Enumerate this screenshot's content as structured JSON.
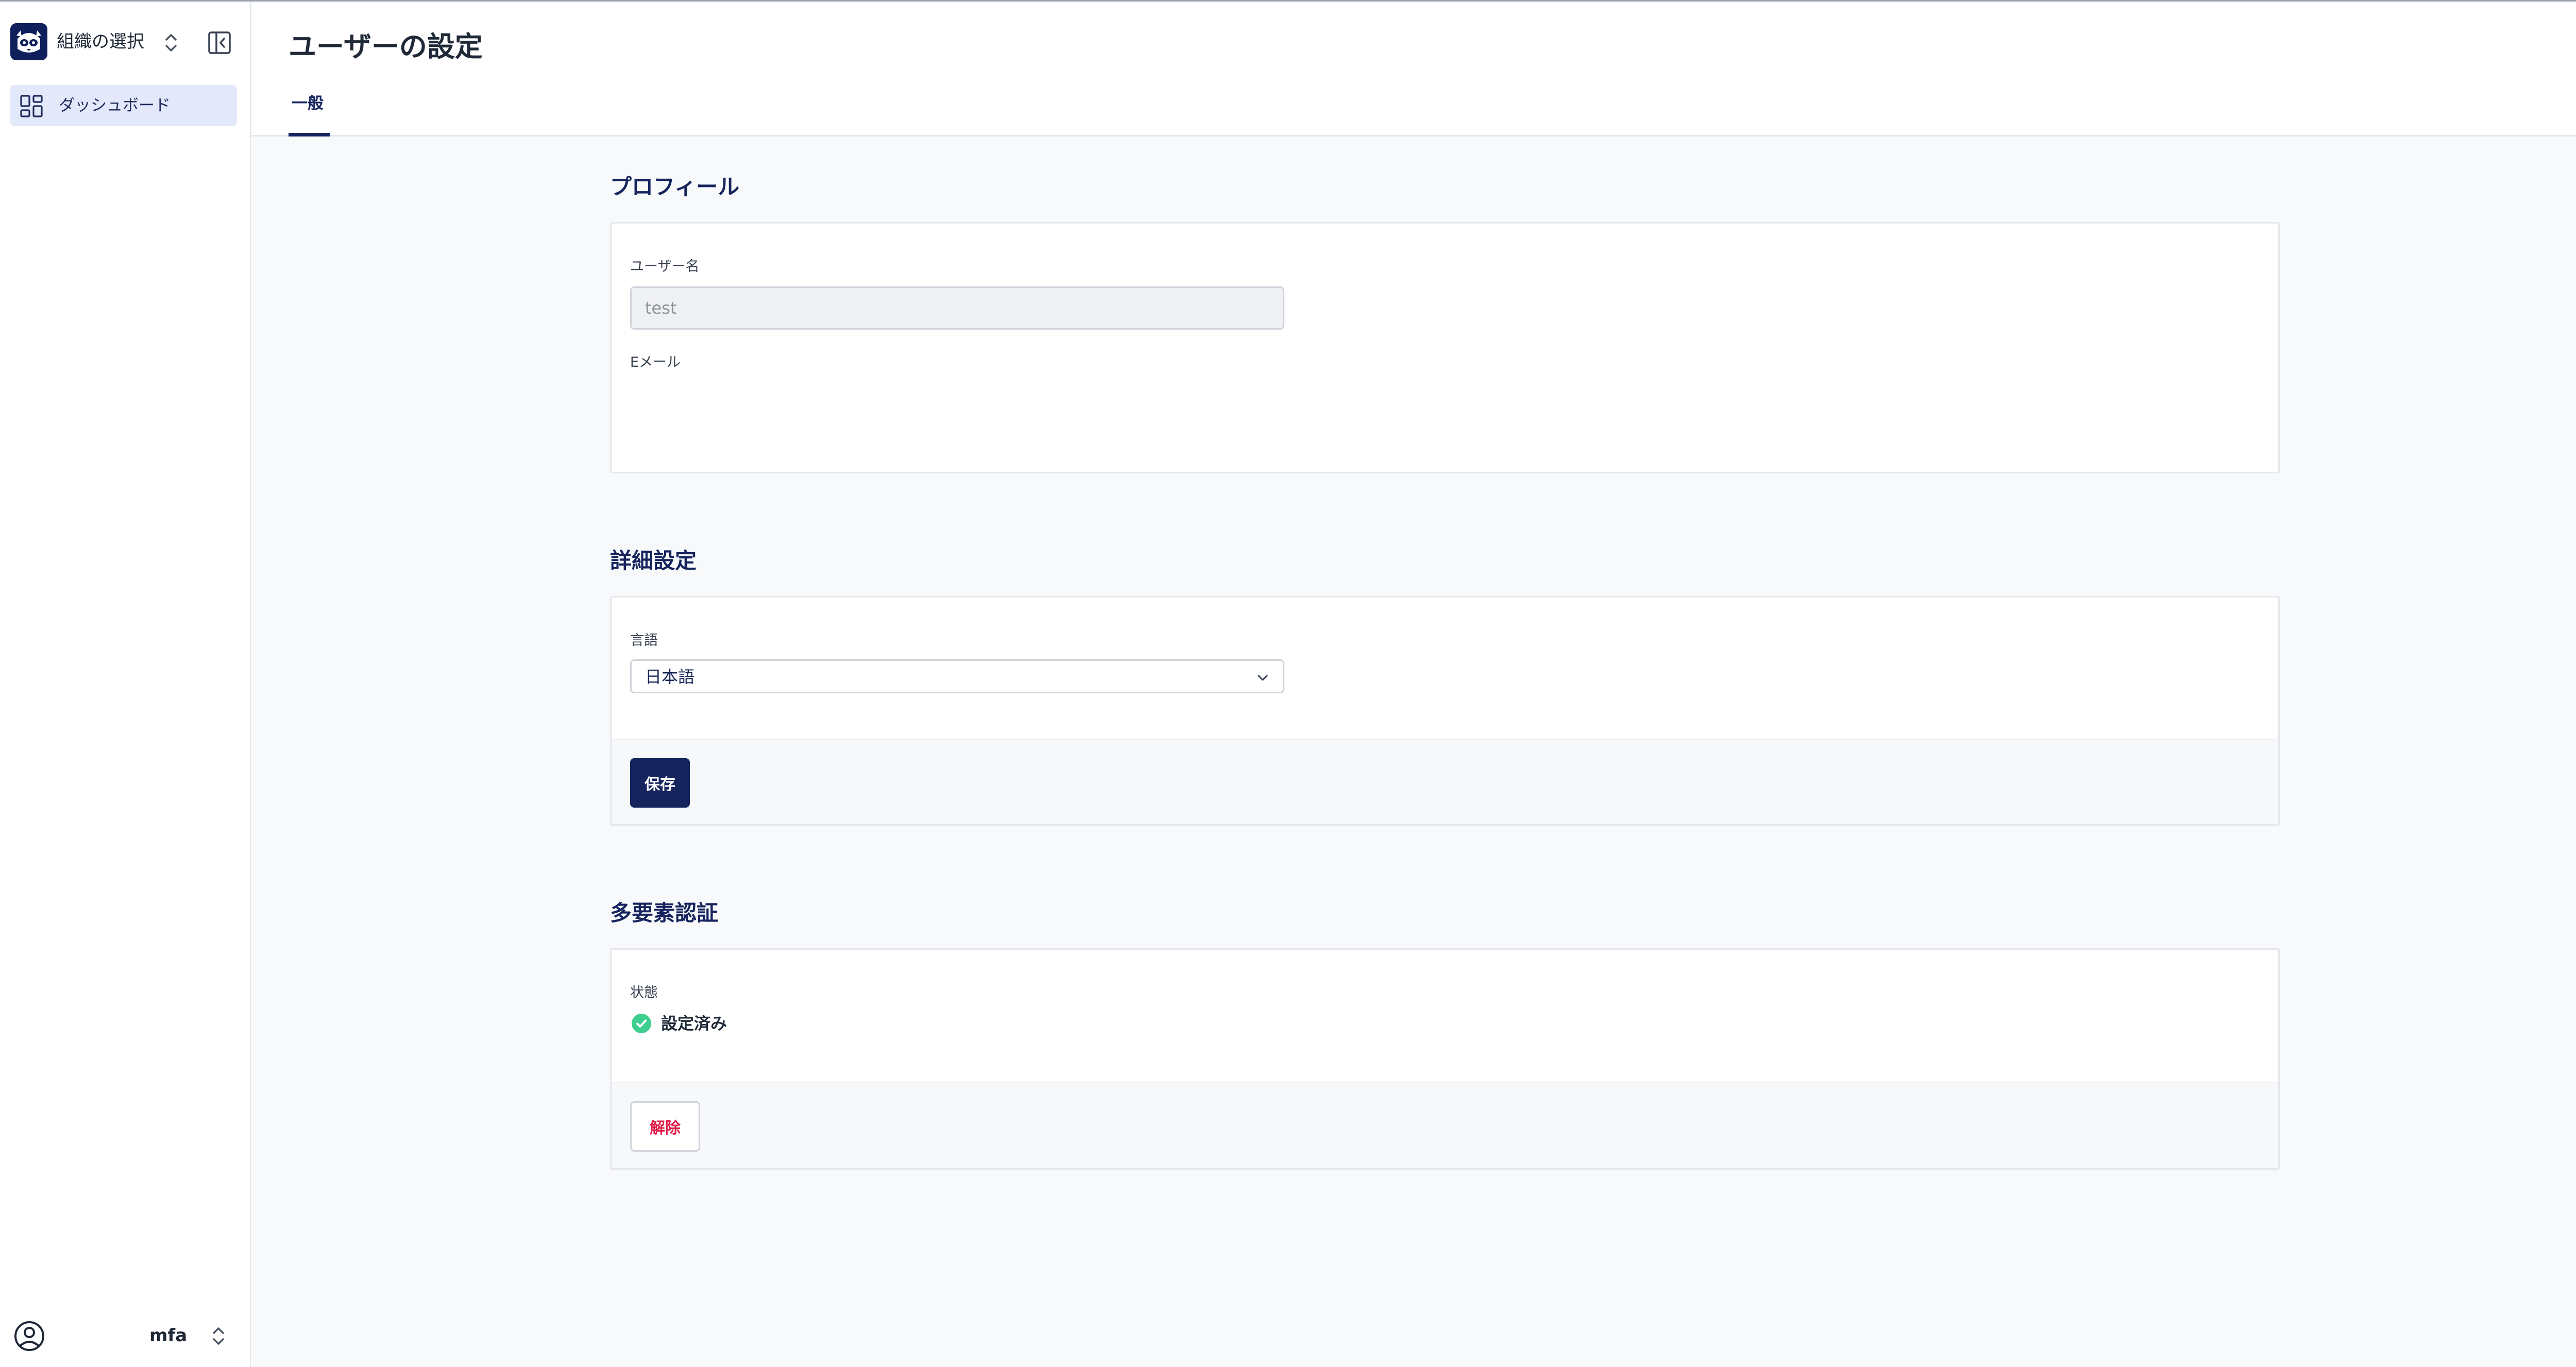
{
  "sidebar": {
    "org_selector_label": "組織の選択",
    "nav_items": [
      {
        "label": "ダッシュボード",
        "icon": "dashboard-icon",
        "active": true
      }
    ],
    "user": {
      "name": "mfa"
    }
  },
  "header": {
    "title": "ユーザーの設定",
    "tabs": [
      {
        "label": "一般",
        "active": true
      }
    ]
  },
  "profile": {
    "title": "プロフィール",
    "username_label": "ユーザー名",
    "username_value": "test",
    "email_label": "Eメール"
  },
  "advanced": {
    "title": "詳細設定",
    "language_label": "言語",
    "language_value": "日本語",
    "save_label": "保存"
  },
  "mfa": {
    "title": "多要素認証",
    "status_label": "状態",
    "status_value": "設定済み",
    "disable_label": "解除"
  },
  "colors": {
    "brand": "#16245e",
    "active_nav_bg": "#e3e9fb",
    "success": "#3ecf8e",
    "danger": "#e11d48"
  }
}
